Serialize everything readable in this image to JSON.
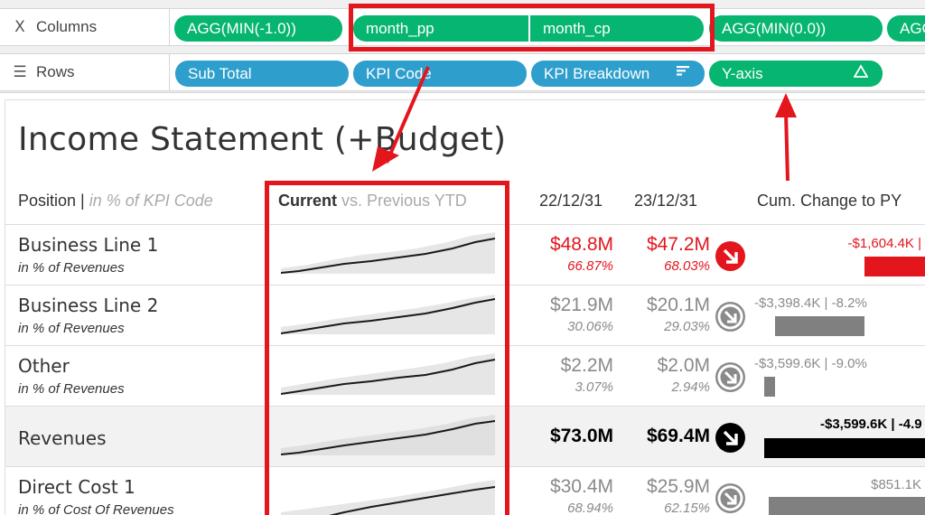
{
  "shelves": {
    "columns": {
      "label": "Columns",
      "icon": "columns-icon",
      "pills": [
        "AGG(MIN(-1.0))",
        "month_pp",
        "month_cp",
        "AGG(MIN(0.0))",
        "AGG"
      ]
    },
    "rows": {
      "label": "Rows",
      "icon": "rows-icon",
      "pills": [
        "Sub Total",
        "KPI Code",
        "KPI Breakdown",
        "Y-axis"
      ],
      "kpi_breakdown_icon": "sort-descending-icon",
      "yaxis_icon": "delta-icon"
    }
  },
  "dashboard": {
    "title": "Income Statement (+Budget)",
    "headers": {
      "position": "Position",
      "position_sep": " | ",
      "position_sub": "in % of KPI Code",
      "current": "Current",
      "current_rest": " vs. Previous YTD",
      "date1": "22/12/31",
      "date2": "23/12/31",
      "cum": "Cum. Change to PY"
    },
    "rows": [
      {
        "label": "Business Line 1",
        "sub": "in % of Revenues",
        "v1": "$48.8M",
        "p1": "66.87%",
        "v2": "$47.2M",
        "p2": "68.03%",
        "color": "red",
        "trend_icon": "trend-down-arrow-icon",
        "cum": "-$1,604.4K |"
      },
      {
        "label": "Business Line 2",
        "sub": "in % of Revenues",
        "v1": "$21.9M",
        "p1": "30.06%",
        "v2": "$20.1M",
        "p2": "29.03%",
        "color": "grey",
        "trend_icon": "trend-down-arrow-icon",
        "cum": "-$3,398.4K | -8.2%"
      },
      {
        "label": "Other",
        "sub": "in % of Revenues",
        "v1": "$2.2M",
        "p1": "3.07%",
        "v2": "$2.0M",
        "p2": "2.94%",
        "color": "grey",
        "trend_icon": "trend-down-arrow-icon",
        "cum": "-$3,599.6K | -9.0%"
      },
      {
        "label": "Revenues",
        "sub": "",
        "v1": "$73.0M",
        "p1": "",
        "v2": "$69.4M",
        "p2": "",
        "color": "black",
        "trend_icon": "trend-down-arrow-icon",
        "cum": "-$3,599.6K | -4.9"
      },
      {
        "label": "Direct Cost 1",
        "sub": "in % of Cost Of Revenues",
        "v1": "$30.4M",
        "p1": "68.94%",
        "v2": "$25.9M",
        "p2": "62.15%",
        "color": "grey",
        "trend_icon": "trend-down-arrow-icon",
        "cum": "$851.1K"
      }
    ]
  },
  "colors": {
    "pill_green": "#06b56f",
    "pill_blue": "#2e9fcd",
    "annotation_red": "#e3151d",
    "value_red": "#e3151d",
    "value_grey": "#8a8a8a",
    "value_black": "#000000"
  }
}
